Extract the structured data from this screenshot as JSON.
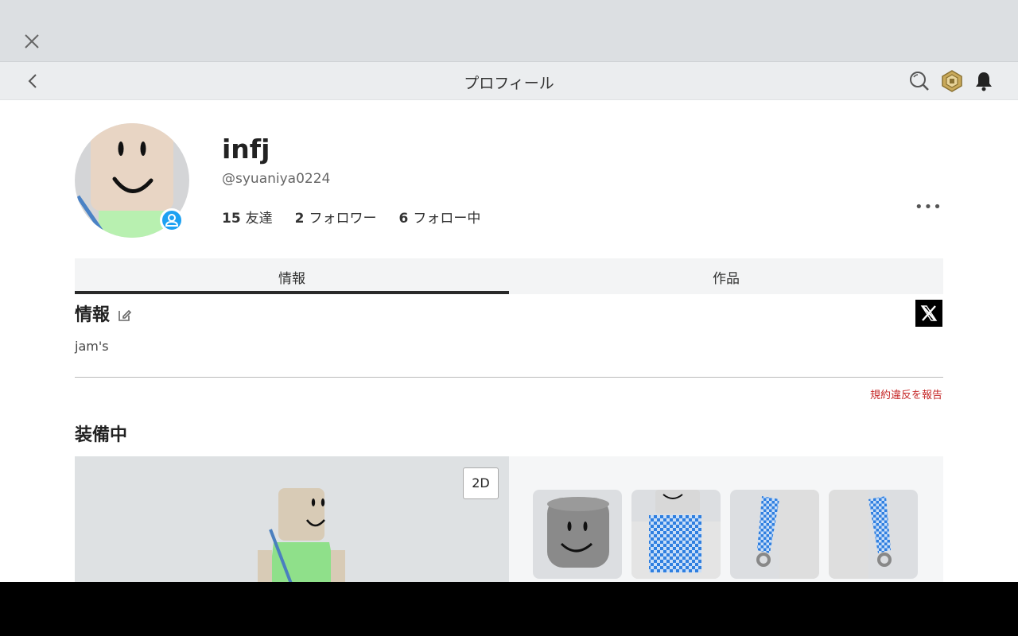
{
  "navbar": {
    "title": "プロフィール",
    "icons": [
      "close-icon",
      "back-icon",
      "search-icon",
      "robux-icon",
      "bell-icon"
    ]
  },
  "profile": {
    "display_name": "infj",
    "username": "@syuaniya0224",
    "stats": [
      {
        "count": "15",
        "label": "友達"
      },
      {
        "count": "2",
        "label": "フォロワー"
      },
      {
        "count": "6",
        "label": "フォロー中"
      }
    ],
    "more_label": "•••"
  },
  "tabs": [
    {
      "label": "情報",
      "active": true
    },
    {
      "label": "作品",
      "active": false
    }
  ],
  "about": {
    "title": "情報",
    "text": "jam's",
    "report_label": "規約違反を報告"
  },
  "wearing": {
    "title": "装備中",
    "toggle_label": "2D"
  },
  "colors": {
    "badge": "#1da1f2",
    "report": "#c62828",
    "tab_indicator": "#2a2a2a"
  }
}
